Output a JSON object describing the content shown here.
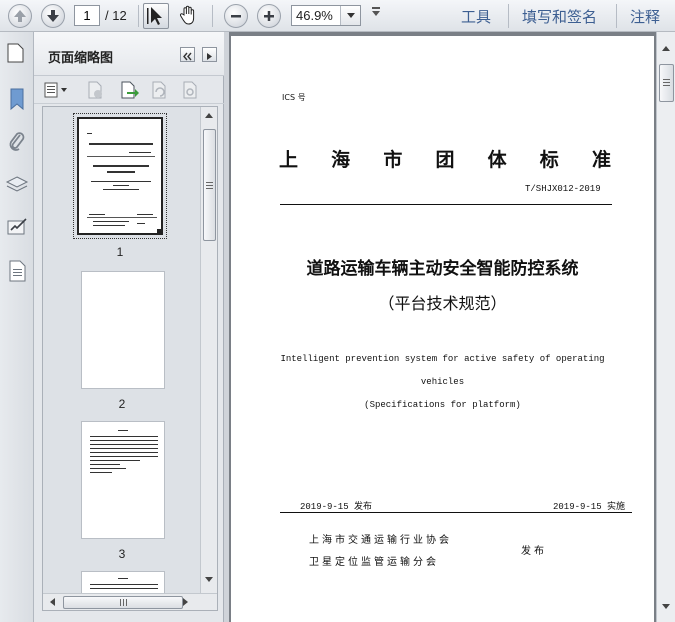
{
  "toolbar": {
    "page_current": "1",
    "page_total": "/ 12",
    "zoom": "46.9%",
    "menu_tools": "工具",
    "menu_fill_sign": "填写和签名",
    "menu_comment": "注释"
  },
  "panel": {
    "title": "页面缩略图",
    "thumbnails": [
      {
        "label": "1"
      },
      {
        "label": "2"
      },
      {
        "label": "3"
      }
    ]
  },
  "document": {
    "ics": "ICS 号",
    "title_chars": [
      "上",
      "海",
      "市",
      "团",
      "体",
      "标",
      "准"
    ],
    "code": "T/SHJX012-2019",
    "main_title": "道路运输车辆主动安全智能防控系统",
    "sub_title": "（平台技术规范）",
    "english_line1": "Intelligent prevention system for active safety of operating",
    "english_line2": "vehicles",
    "english_line3": "(Specifications for platform)",
    "release_date": "2019-9-15 发布",
    "implement_date": "2019-9-15 实施",
    "org1": "上海市交通运输行业协会",
    "org2": "卫星定位监管运输分会",
    "issue": "发布"
  },
  "colors": {
    "menu_link": "#3d5f92",
    "toolbar_bg": "#e4e7eb",
    "doc_bg": "#7a7f86"
  }
}
